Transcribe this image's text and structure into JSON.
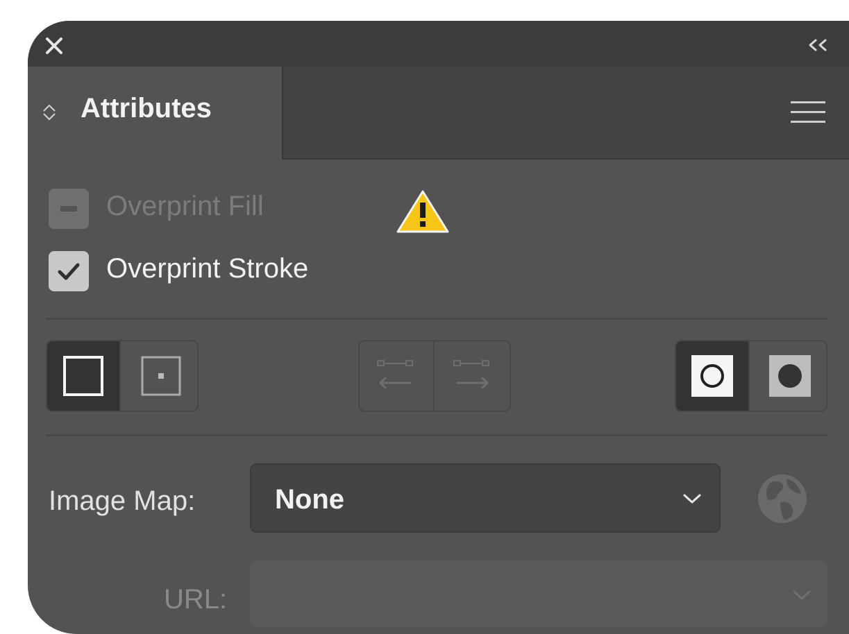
{
  "window": {
    "close_icon": "close-icon",
    "collapse_icon": "double-chevron-left-icon"
  },
  "tab": {
    "title": "Attributes",
    "arrows_icon": "tab-expand-arrows-icon",
    "menu_icon": "hamburger-menu-icon"
  },
  "overprint_fill": {
    "label": "Overprint Fill",
    "state": "mixed",
    "enabled": false,
    "warning_icon": "warning-icon"
  },
  "overprint_stroke": {
    "label": "Overprint Stroke",
    "checked": true
  },
  "fill_rule_group": {
    "selected": "show-center-off",
    "buttons": [
      "show-center-off-icon",
      "show-center-on-icon"
    ]
  },
  "direction_group": {
    "enabled": false,
    "buttons": [
      "reverse-path-direction-off-icon",
      "reverse-path-direction-on-icon"
    ]
  },
  "winding_group": {
    "selected": "non-zero-winding",
    "buttons": [
      "non-zero-winding-fill-icon",
      "even-odd-fill-icon"
    ]
  },
  "image_map": {
    "label": "Image Map:",
    "value": "None",
    "chevron_icon": "chevron-down-icon",
    "browser_icon": "globe-icon"
  },
  "url": {
    "label": "URL:",
    "value": "",
    "enabled": false,
    "chevron_icon": "chevron-down-icon"
  },
  "colors": {
    "panel_bg": "#535353",
    "titlebar_bg": "#3c3c3c",
    "tabstrip_bg": "#434343",
    "text_primary": "#f2f2f2",
    "text_disabled": "#7c7c7c",
    "warning_yellow": "#f5c518"
  }
}
